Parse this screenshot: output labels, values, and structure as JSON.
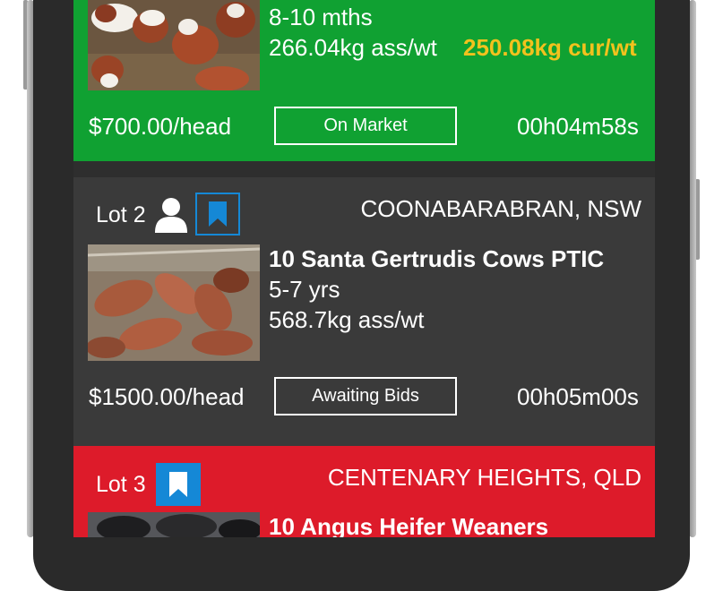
{
  "lots": [
    {
      "status_color": "#10a132",
      "age": "8-10 mths",
      "assessed_weight": "266.04kg ass/wt",
      "current_weight": "250.08kg cur/wt",
      "current_weight_color": "#f2c21d",
      "price": "$700.00/head",
      "status": "On Market",
      "timer": "00h04m58s",
      "image_icon": "cattle-photo"
    },
    {
      "lot_label": "Lot 2",
      "location": "COONABARABRAN, NSW",
      "title": "10 Santa Gertrudis Cows PTIC",
      "age": "5-7 yrs",
      "assessed_weight": "568.7kg ass/wt",
      "price": "$1500.00/head",
      "status": "Awaiting Bids",
      "timer": "00h05m00s",
      "user_icon": "user-icon",
      "bookmark_icon": "bookmark-icon",
      "image_icon": "cattle-photo"
    },
    {
      "status_color": "#dd1b2a",
      "lot_label": "Lot 3",
      "location": "CENTENARY HEIGHTS, QLD",
      "title": "10 Angus Heifer Weaners",
      "bookmark_icon": "bookmark-icon",
      "image_icon": "cattle-photo"
    }
  ],
  "colors": {
    "accent_blue": "#1588d6",
    "dark_card": "#3a3a3a",
    "gold_text": "#f2c21d"
  }
}
